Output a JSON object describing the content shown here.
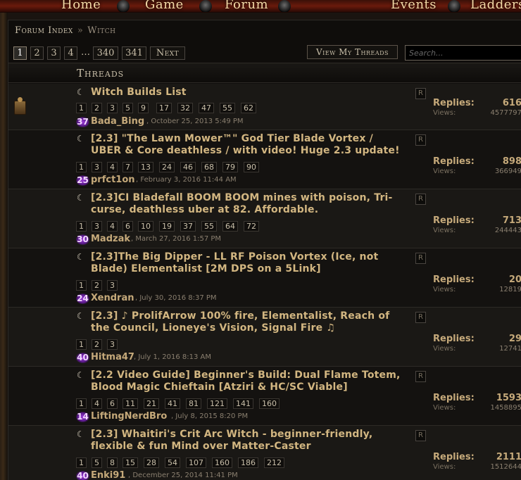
{
  "nav": {
    "items": [
      "Home",
      "Game",
      "Forum",
      "Events",
      "Ladders"
    ]
  },
  "breadcrumb": {
    "root": "Forum Index",
    "separator": "»",
    "current": "Witch"
  },
  "pagination": {
    "pages": [
      "1",
      "2",
      "3",
      "4"
    ],
    "ellipsis": "…",
    "tail": [
      "340",
      "341"
    ],
    "next": "Next",
    "current": "1"
  },
  "actions": {
    "view_my_threads": "View My Threads"
  },
  "search": {
    "placeholder": "Search..."
  },
  "threads_header": "Threads",
  "threads": [
    {
      "title": "Witch Builds List",
      "pages": [
        "1",
        "2",
        "3",
        "5",
        "9",
        "17",
        "32",
        "47",
        "55",
        "62"
      ],
      "badge": "37",
      "author": "Bada_Bing",
      "date": ", October 25, 2013 5:49 PM",
      "rbadge": "R",
      "replies_label": "Replies:",
      "replies": "616",
      "views_label": "Views:",
      "views": "4577797",
      "sticky": true
    },
    {
      "title": "[2.3] \"The Lawn Mower™\" God Tier Blade Vortex / UBER & Core deathless / with video! Huge 2.3 update!",
      "pages": [
        "1",
        "3",
        "4",
        "7",
        "13",
        "24",
        "46",
        "68",
        "79",
        "90"
      ],
      "badge": "25",
      "author": "prfct1on",
      "date": ", February 3, 2016 11:44 AM",
      "rbadge": "R",
      "replies_label": "Replies:",
      "replies": "898",
      "views_label": "Views:",
      "views": "366949",
      "sticky": false
    },
    {
      "title": "[2.3]CI Bladefall BOOM BOOM mines with poison, Tri-curse, deathless uber at 82. Affordable.",
      "pages": [
        "1",
        "3",
        "4",
        "6",
        "10",
        "19",
        "37",
        "55",
        "64",
        "72"
      ],
      "badge": "30",
      "author": "Madzak",
      "date": ", March 27, 2016 1:57 PM",
      "rbadge": "R",
      "replies_label": "Replies:",
      "replies": "713",
      "views_label": "Views:",
      "views": "244443",
      "sticky": false
    },
    {
      "title": "[2.3]The Big Dipper - LL RF Poison Vortex (Ice, not Blade) Elementalist [2M DPS on a 5Link]",
      "pages": [
        "1",
        "2",
        "3"
      ],
      "badge": "24",
      "author": "Xendran",
      "date": ", July 30, 2016 8:37 PM",
      "rbadge": "R",
      "replies_label": "Replies:",
      "replies": "20",
      "views_label": "Views:",
      "views": "12819",
      "sticky": false
    },
    {
      "title": "[2.3] ♪ ProlifArrow 100% fire, Elementalist, Reach of the Council, Lioneye's Vision, Signal Fire ♫",
      "pages": [
        "1",
        "2",
        "3"
      ],
      "badge": "40",
      "author": "Hitma47",
      "date": ", July 1, 2016 8:13 AM",
      "rbadge": "R",
      "replies_label": "Replies:",
      "replies": "29",
      "views_label": "Views:",
      "views": "12741",
      "sticky": false
    },
    {
      "title": "[2.2 Video Guide] Beginner's Build: Dual Flame Totem, Blood Magic Chieftain [Atziri & HC/SC Viable]",
      "pages": [
        "1",
        "4",
        "6",
        "11",
        "21",
        "41",
        "81",
        "121",
        "141",
        "160"
      ],
      "badge": "14",
      "author": "LiftingNerdBro",
      "date": ", July 8, 2015 8:20 PM",
      "rbadge": "R",
      "replies_label": "Replies:",
      "replies": "1593",
      "views_label": "Views:",
      "views": "1458895",
      "sticky": false
    },
    {
      "title": "[2.3] Whaitiri's Crit Arc Witch - beginner-friendly, flexible & fun Mind over Matter-Caster",
      "pages": [
        "1",
        "5",
        "8",
        "15",
        "28",
        "54",
        "107",
        "160",
        "186",
        "212"
      ],
      "badge": "40",
      "author": "Enki91",
      "date": ", December 25, 2014 11:41 PM",
      "rbadge": "R",
      "replies_label": "Replies:",
      "replies": "2111",
      "views_label": "Views:",
      "views": "1512644",
      "sticky": false
    }
  ],
  "colors": {
    "title": "#d2b681",
    "accent_badge": "#9a3ad8",
    "nav_bg": "#6a1a0c"
  }
}
